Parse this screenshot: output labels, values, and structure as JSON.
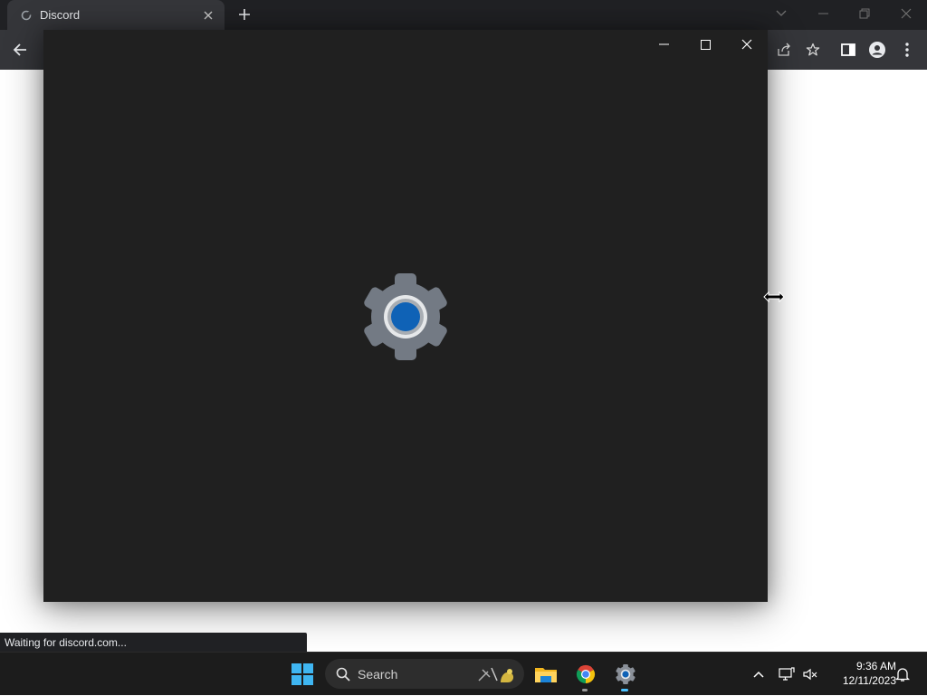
{
  "browser": {
    "tab": {
      "title": "Discord",
      "favicon": "discord-loading-icon"
    },
    "new_tab_icon": "plus-icon",
    "window_controls": [
      "chevron-down-icon",
      "minimize-icon",
      "restore-icon",
      "close-icon"
    ],
    "toolbar_icons": [
      "back-arrow-icon",
      "share-icon",
      "star-icon",
      "side-panel-icon",
      "profile-icon",
      "menu-dots-icon"
    ],
    "status_text": "Waiting for discord.com..."
  },
  "settings_window": {
    "controls": [
      "minimize-icon",
      "maximize-icon",
      "close-icon"
    ],
    "splash_icon": "settings-gear-icon"
  },
  "taskbar": {
    "search_label": "Search",
    "apps": [
      "windows-start-icon",
      "file-explorer-icon",
      "chrome-icon",
      "settings-icon"
    ],
    "tray_icons": [
      "chevron-up-icon",
      "network-icon",
      "volume-muted-icon",
      "notification-bell-icon"
    ],
    "time": "9:36 AM",
    "date": "12/11/2023"
  },
  "colors": {
    "app_background": "#202020",
    "browser_dark": "#35363a",
    "accent_blue": "#0f62b6",
    "taskbar": "#1c1c1c"
  }
}
